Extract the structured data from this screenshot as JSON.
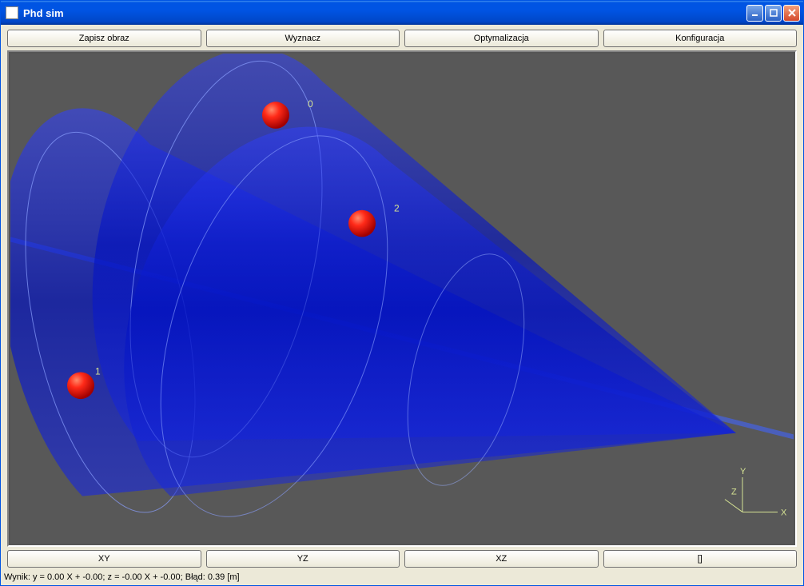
{
  "window": {
    "title": "Phd sim"
  },
  "toolbar_top": {
    "btn1": "Zapisz obraz",
    "btn2": "Wyznacz",
    "btn3": "Optymalizacja",
    "btn4": "Konfiguracja"
  },
  "toolbar_bottom": {
    "btn1": "XY",
    "btn2": "YZ",
    "btn3": "XZ",
    "btn4": "[]"
  },
  "viewport": {
    "points": [
      {
        "id": "0",
        "label": "0"
      },
      {
        "id": "1",
        "label": "1"
      },
      {
        "id": "2",
        "label": "2"
      }
    ],
    "axes": {
      "x": "X",
      "y": "Y",
      "z": "Z"
    }
  },
  "status": {
    "text": "Wynik: y = 0.00 X + -0.00; z = -0.00 X + -0.00; Błąd: 0.39 [m]"
  }
}
